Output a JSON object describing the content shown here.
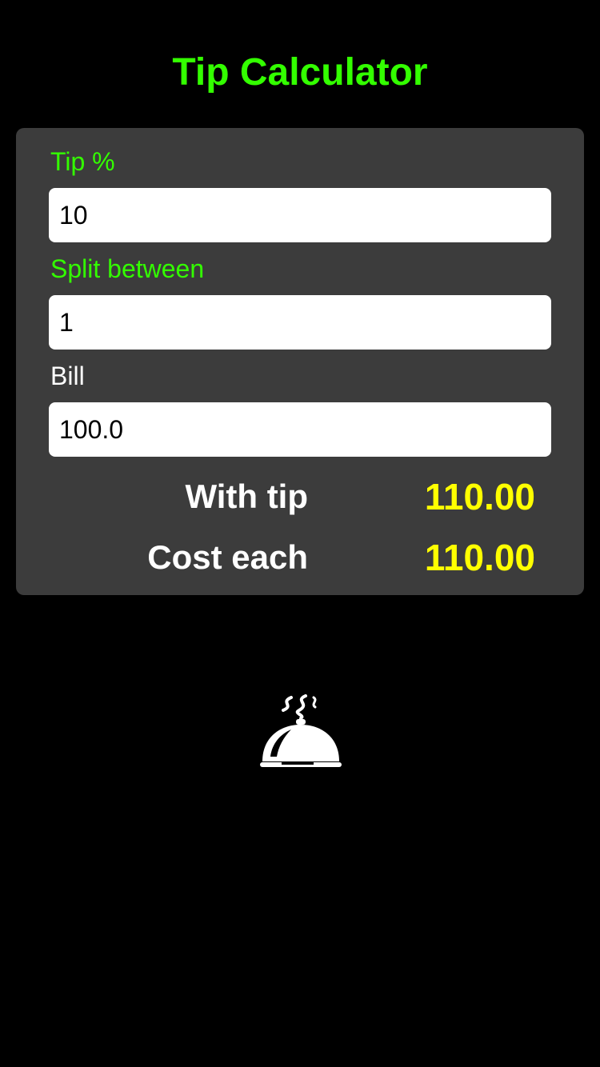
{
  "header": {
    "title": "Tip Calculator"
  },
  "form": {
    "tip_label": "Tip %",
    "tip_value": "10",
    "split_label": "Split between",
    "split_value": "1",
    "bill_label": "Bill",
    "bill_value": "100.0"
  },
  "results": {
    "with_tip_label": "With tip",
    "with_tip_value": "110.00",
    "cost_each_label": "Cost each",
    "cost_each_value": "110.00"
  },
  "colors": {
    "title": "#33ff00",
    "accent_label": "#33ff00",
    "result_value": "#ffff00",
    "card_background": "#3c3c3c",
    "background": "#000000"
  },
  "icons": {
    "footer_icon": "service-bell-icon"
  }
}
